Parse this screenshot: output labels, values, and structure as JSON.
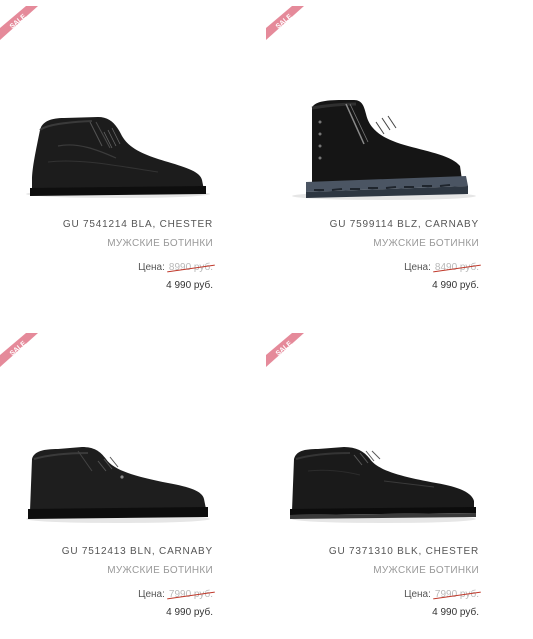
{
  "colors": {
    "sale_badge": "#e58a9a",
    "strike": "#c0392b",
    "old_price": "#b8b8b8",
    "category": "#999999"
  },
  "products": [
    {
      "badge": "SALE",
      "name": "GU 7541214 BLA, CHESTER",
      "category": "МУЖСКИЕ БОТИНКИ",
      "price_label": "Цена:",
      "old_price": "8990 руб.",
      "new_price": "4 990 руб."
    },
    {
      "badge": "SALE",
      "name": "GU 7599114 BLZ, CARNABY",
      "category": "МУЖСКИЕ БОТИНКИ",
      "price_label": "Цена:",
      "old_price": "8490 руб.",
      "new_price": "4 990 руб."
    },
    {
      "badge": "SALE",
      "name": "GU 7512413 BLN, CARNABY",
      "category": "МУЖСКИЕ БОТИНКИ",
      "price_label": "Цена:",
      "old_price": "7990 руб.",
      "new_price": "4 990 руб."
    },
    {
      "badge": "SALE",
      "name": "GU 7371310 BLK, CHESTER",
      "category": "МУЖСКИЕ БОТИНКИ",
      "price_label": "Цена:",
      "old_price": "7990 руб.",
      "new_price": "4 990 руб."
    }
  ]
}
